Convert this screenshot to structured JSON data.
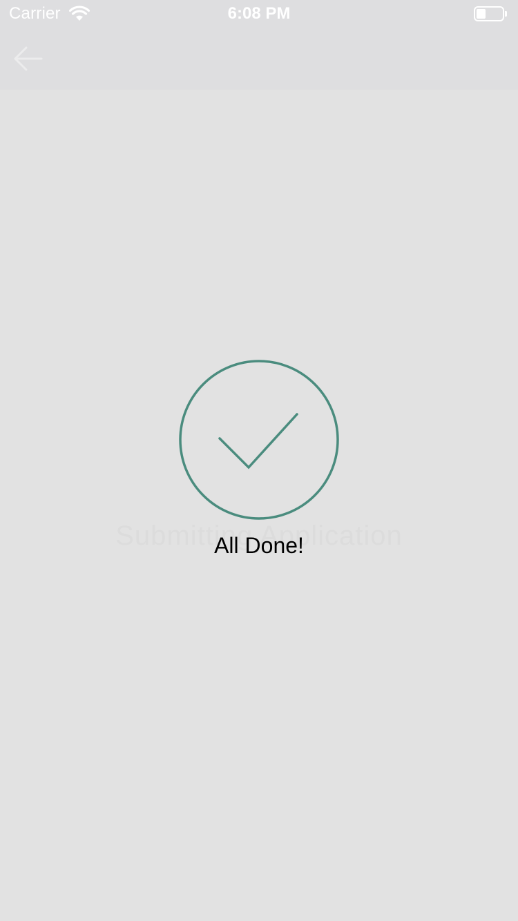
{
  "status_bar": {
    "carrier": "Carrier",
    "time": "6:08 PM",
    "wifi_icon": "wifi-icon",
    "battery_icon": "battery-icon"
  },
  "nav_bar": {
    "back_icon": "arrow-left-icon"
  },
  "main": {
    "success_icon": "check-circle-icon",
    "background_text": "Submitting Application",
    "message": "All Done!"
  },
  "colors": {
    "accent": "#4a8c7e",
    "background": "#e2e2e2",
    "bar_background": "#dedee0"
  }
}
